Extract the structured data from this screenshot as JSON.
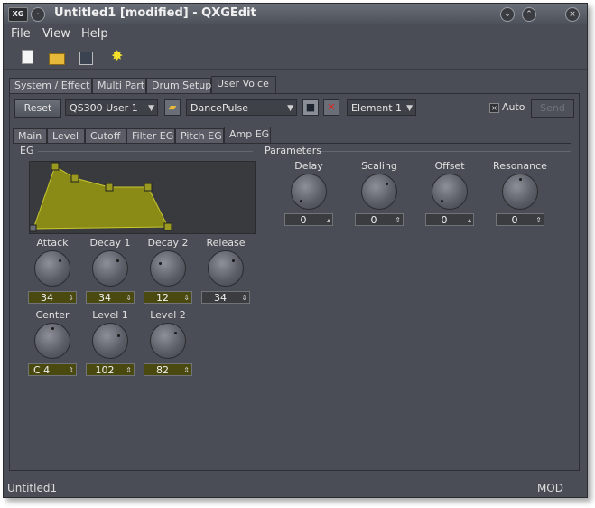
{
  "window": {
    "title": "Untitled1 [modified] - QXGEdit",
    "logo": "XG"
  },
  "menu": [
    "File",
    "View",
    "Help"
  ],
  "toolbar_icons": [
    "new-file-icon",
    "open-folder-icon",
    "save-disk-icon",
    "star-burst-icon"
  ],
  "main_tabs": [
    "System / Effect",
    "Multi Part",
    "Drum Setup",
    "User Voice"
  ],
  "active_main_tab": "User Voice",
  "controls": {
    "reset_label": "Reset",
    "bank": "QS300 User 1",
    "voice_name": "DancePulse",
    "element": "Element 1",
    "auto_label": "Auto",
    "auto_checked": "×",
    "send_label": "Send"
  },
  "sub_tabs": [
    "Main",
    "Level",
    "Cutoff",
    "Filter EG",
    "Pitch EG",
    "Amp EG"
  ],
  "active_sub_tab": "Amp EG",
  "eg": {
    "label": "EG",
    "knobs_row1": [
      {
        "label": "Attack",
        "value": "34"
      },
      {
        "label": "Decay 1",
        "value": "34"
      },
      {
        "label": "Decay 2",
        "value": "12"
      },
      {
        "label": "Release",
        "value": "34"
      }
    ],
    "knobs_row2": [
      {
        "label": "Center",
        "value": "C  4"
      },
      {
        "label": "Level 1",
        "value": "102"
      },
      {
        "label": "Level 2",
        "value": "82"
      }
    ]
  },
  "parameters": {
    "label": "Parameters",
    "knobs": [
      {
        "label": "Delay",
        "value": "0"
      },
      {
        "label": "Scaling",
        "value": "0"
      },
      {
        "label": "Offset",
        "value": "0"
      },
      {
        "label": "Resonance",
        "value": "0"
      }
    ]
  },
  "status": {
    "left": "Untitled1",
    "right": "MOD"
  },
  "colors": {
    "eg_fill": "#8a8a16",
    "window_bg": "#4a4d55"
  }
}
